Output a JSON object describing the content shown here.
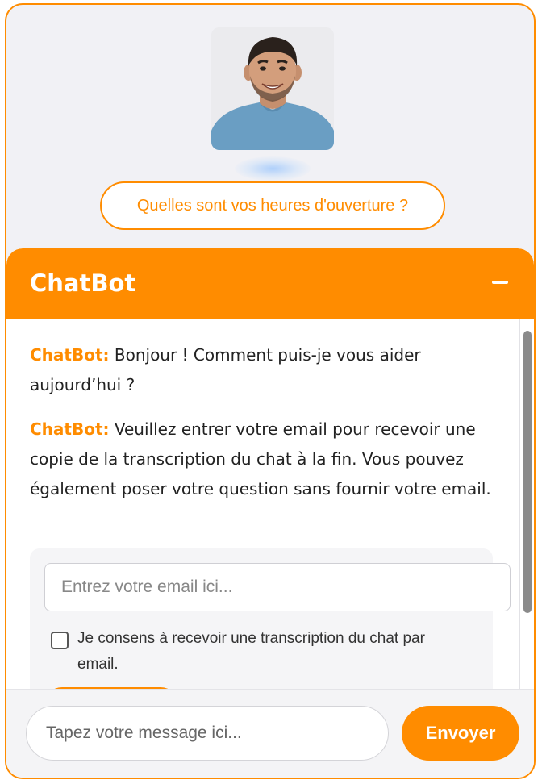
{
  "avatar": {
    "icon": "person-avatar-icon"
  },
  "suggestion": {
    "label": "Quelles sont vos heures d'ouverture ?"
  },
  "chat": {
    "title": "ChatBot",
    "minimize_icon": "minus-icon",
    "messages": [
      {
        "sender": "ChatBot:",
        "text": "Bonjour ! Comment puis-je vous aider aujourd’hui ?"
      },
      {
        "sender": "ChatBot:",
        "text": "Veuillez entrer votre email pour recevoir une copie de la transcription du chat à la fin. Vous pouvez également poser votre question sans fournir votre email."
      }
    ],
    "email_form": {
      "email_placeholder": "Entrez votre email ici...",
      "email_value": "",
      "consent_label": "Je consens à recevoir une transcription du chat par email.",
      "consent_checked": false
    },
    "composer": {
      "message_placeholder": "Tapez votre message ici...",
      "message_value": "",
      "send_label": "Envoyer"
    }
  },
  "colors": {
    "accent": "#ff8c00",
    "panel_background": "#f1f1f5",
    "text": "#222222"
  }
}
